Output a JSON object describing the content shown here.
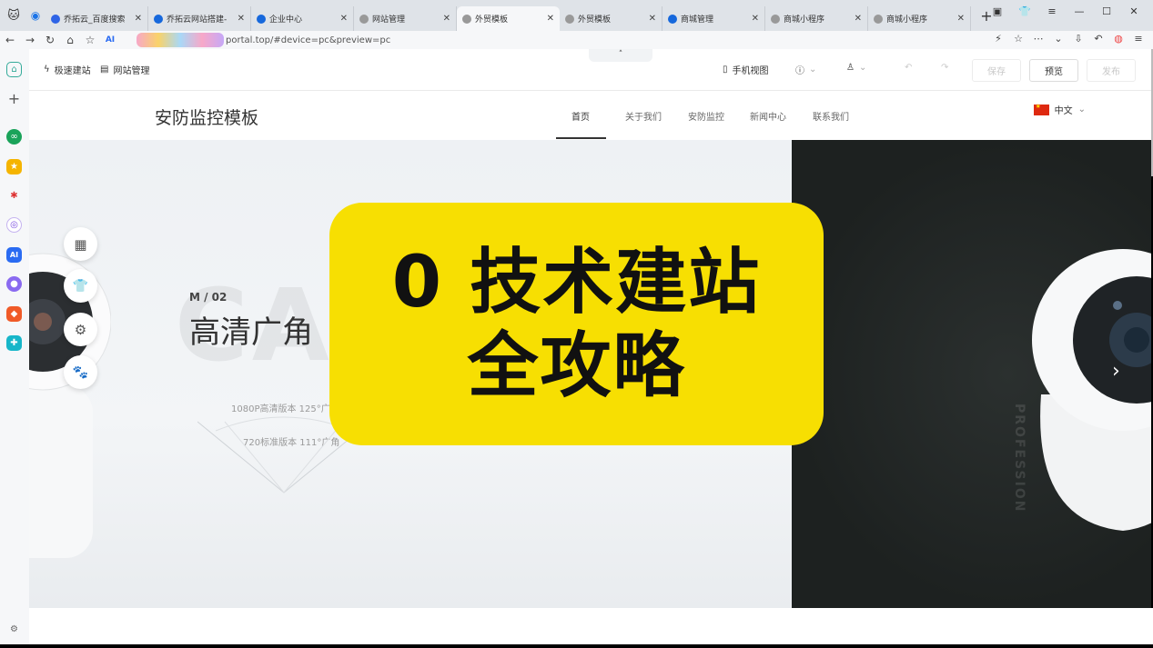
{
  "browser": {
    "tabs": [
      {
        "label": "乔拓云_百度搜索",
        "color": "#2f64e6"
      },
      {
        "label": "乔拓云网站搭建-",
        "color": "#1668dc"
      },
      {
        "label": "企业中心",
        "color": "#1668dc"
      },
      {
        "label": "网站管理",
        "color": "#999999"
      },
      {
        "label": "外贸模板",
        "color": "#999999",
        "active": true
      },
      {
        "label": "外贸模板",
        "color": "#999999"
      },
      {
        "label": "商城管理",
        "color": "#1668dc"
      },
      {
        "label": "商城小程序",
        "color": "#999999"
      },
      {
        "label": "商城小程序",
        "color": "#999999"
      }
    ],
    "url": "portal.top/#device=pc&preview=pc"
  },
  "toolbar": {
    "quick_build": "极速建站",
    "site_manage": "网站管理",
    "mobile_view": "手机视图",
    "save": "保存",
    "preview": "预览",
    "publish": "发布"
  },
  "site": {
    "title": "安防监控模板",
    "nav": [
      "首页",
      "关于我们",
      "安防监控",
      "新闻中心",
      "联系我们"
    ],
    "lang": "中文"
  },
  "banner": {
    "ghost": "CAI",
    "model": "M / 02",
    "headline": "高清广角",
    "spec1": "1080P高清版本 125°广角",
    "spec2": "720标准版本 111°广角",
    "vertical": "PROFESSION"
  },
  "overlay": {
    "line1": "0 技术建站",
    "line2": "全攻略",
    "bg": "#f7df02"
  }
}
